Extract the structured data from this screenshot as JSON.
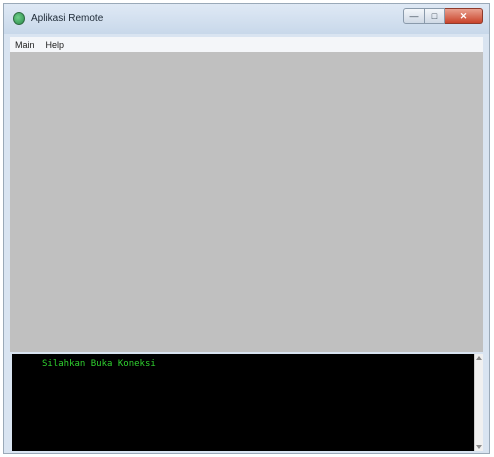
{
  "window": {
    "title": "Aplikasi Remote",
    "icon": "app-icon",
    "controls": {
      "minimize_icon": "minimize-icon",
      "maximize_icon": "maximize-icon",
      "close_icon": "close-icon"
    }
  },
  "menubar": {
    "items": [
      {
        "label": "Main"
      },
      {
        "label": "Help"
      }
    ]
  },
  "console": {
    "text": "Silahkan Buka Koneksi",
    "text_color": "#2fd12f",
    "background": "#000000"
  },
  "colors": {
    "main_area": "#c0c0c0",
    "close_button": "#c9432a"
  }
}
